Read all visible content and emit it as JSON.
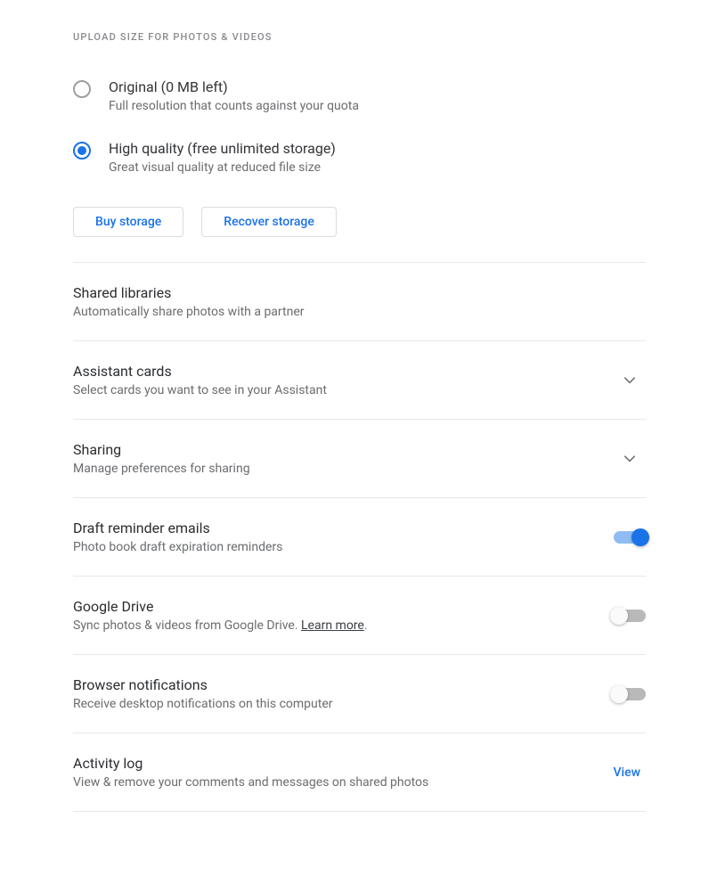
{
  "header": "UPLOAD SIZE FOR PHOTOS & VIDEOS",
  "uploadOptions": {
    "original": {
      "title": "Original (0 MB left)",
      "desc": "Full resolution that counts against your quota"
    },
    "highQuality": {
      "title": "High quality (free unlimited storage)",
      "desc": "Great visual quality at reduced file size"
    }
  },
  "buttons": {
    "buyStorage": "Buy storage",
    "recoverStorage": "Recover storage"
  },
  "settings": {
    "sharedLibraries": {
      "title": "Shared libraries",
      "desc": "Automatically share photos with a partner"
    },
    "assistantCards": {
      "title": "Assistant cards",
      "desc": "Select cards you want to see in your Assistant"
    },
    "sharing": {
      "title": "Sharing",
      "desc": "Manage preferences for sharing"
    },
    "draftReminder": {
      "title": "Draft reminder emails",
      "desc": "Photo book draft expiration reminders"
    },
    "googleDrive": {
      "title": "Google Drive",
      "descPrefix": "Sync photos & videos from Google Drive. ",
      "learnMore": "Learn more",
      "descSuffix": "."
    },
    "browserNotifications": {
      "title": "Browser notifications",
      "desc": "Receive desktop notifications on this computer"
    },
    "activityLog": {
      "title": "Activity log",
      "desc": "View & remove your comments and messages on shared photos",
      "action": "View"
    }
  }
}
